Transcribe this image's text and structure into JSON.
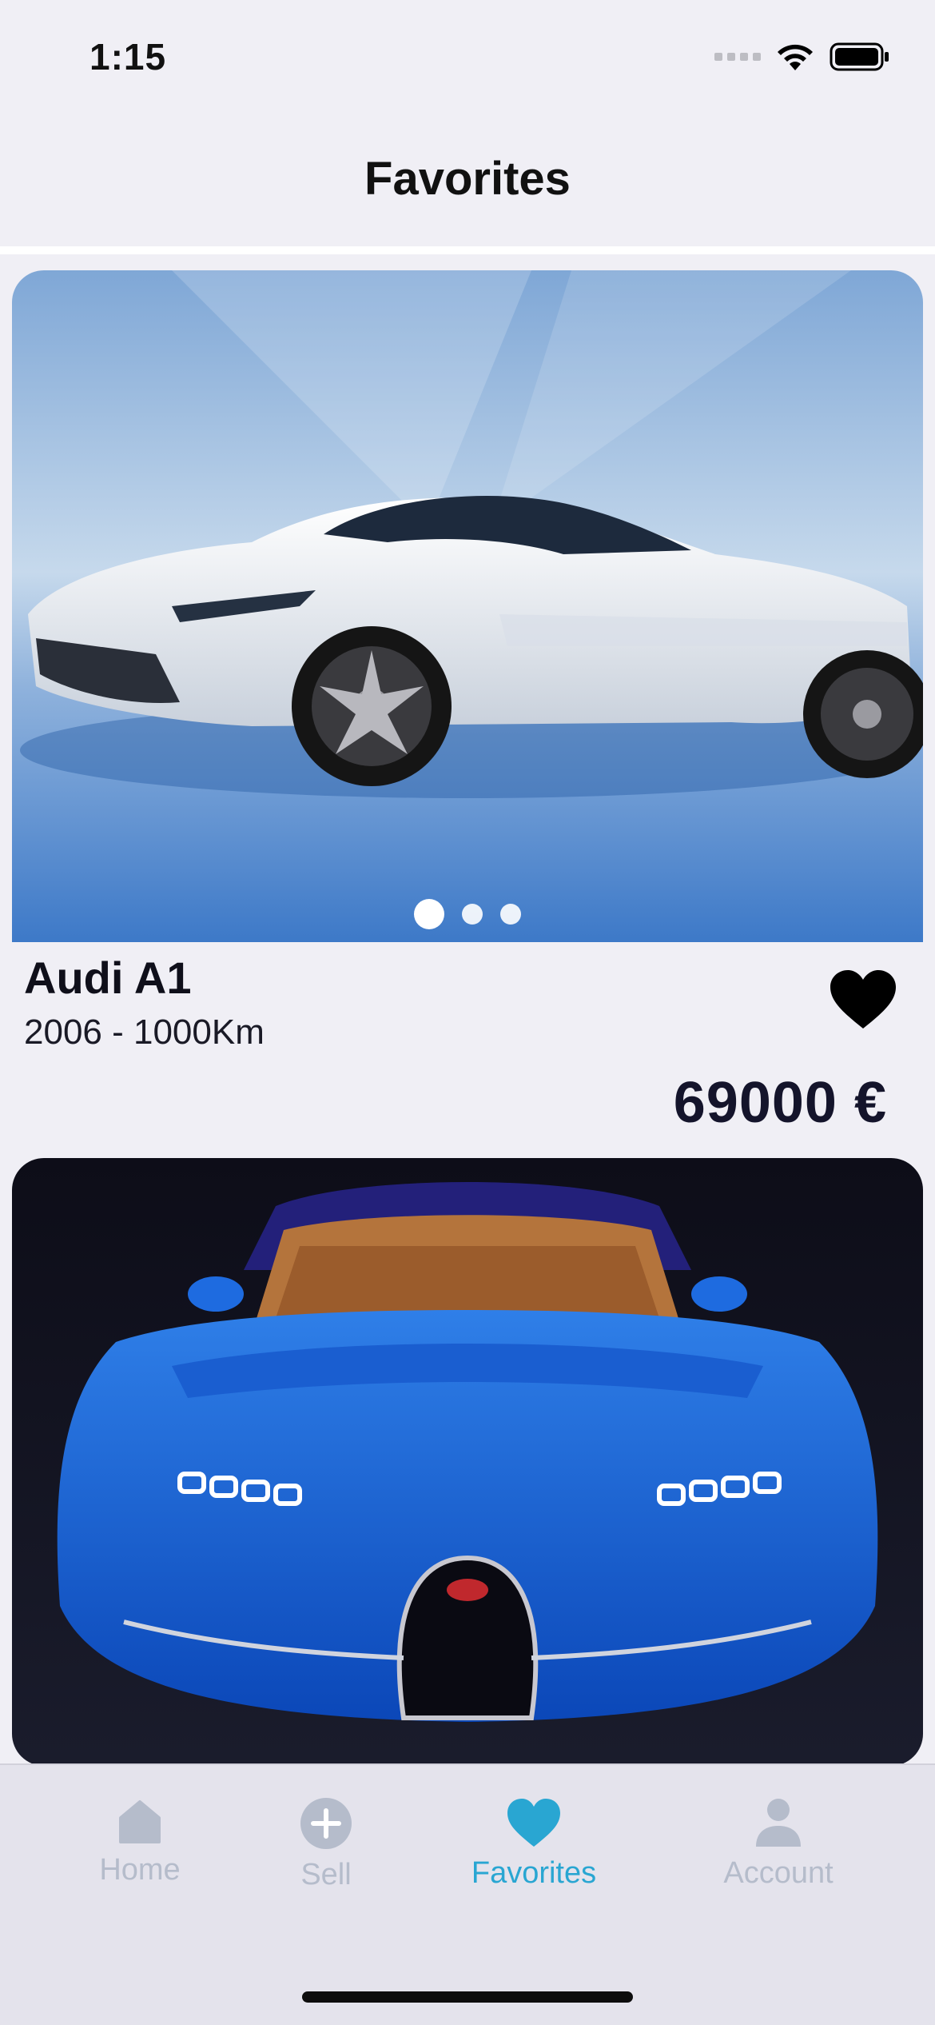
{
  "status_bar": {
    "time": "1:15"
  },
  "header": {
    "title": "Favorites"
  },
  "listings": [
    {
      "name": "Audi A1",
      "meta": "2006 - 1000Km",
      "price": "69000 €",
      "photo": "white-sports-car-photo",
      "carousel": {
        "count": 3,
        "active": 0
      },
      "favorited": true
    },
    {
      "photo": "blue-hypercar-photo"
    }
  ],
  "tab_bar": {
    "items": [
      {
        "label": "Home",
        "icon": "home-icon",
        "active": false
      },
      {
        "label": "Sell",
        "icon": "plus-circle-icon",
        "active": false
      },
      {
        "label": "Favorites",
        "icon": "heart-icon",
        "active": true
      },
      {
        "label": "Account",
        "icon": "person-icon",
        "active": false
      }
    ]
  },
  "colors": {
    "accent": "#29a6d2",
    "inactive_tab": "#b5bccb",
    "background": "#f0eff5",
    "text": "#111111"
  }
}
